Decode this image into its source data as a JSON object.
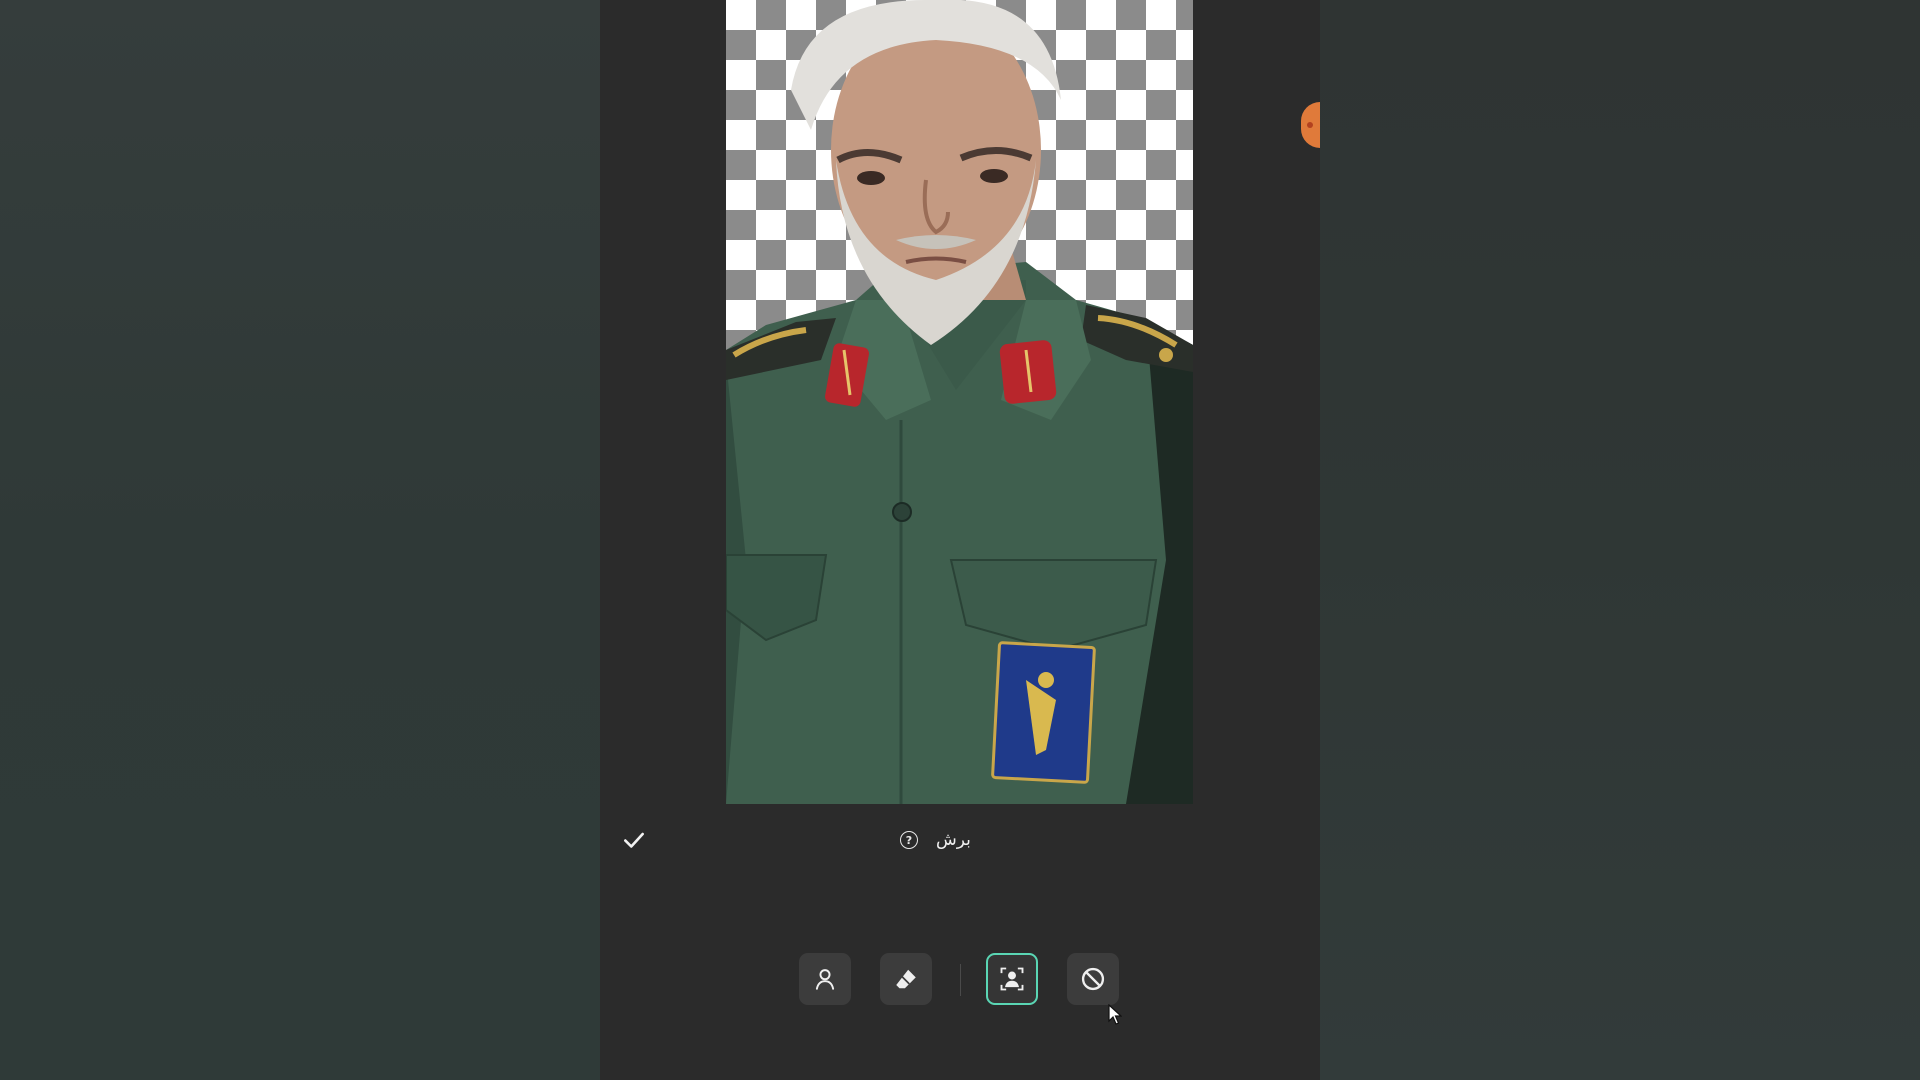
{
  "editor": {
    "title": "برش",
    "help_icon": "?"
  },
  "icons": {
    "confirm": "checkmark-icon",
    "help": "question-circle-icon",
    "tools": [
      "person-outline-icon",
      "eraser-icon",
      "person-select-icon",
      "prohibit-icon"
    ]
  },
  "tools": {
    "active_index": 2
  },
  "colors": {
    "accent": "#5ad6b4",
    "panel": "#2b2b2b",
    "tool_bg": "#3c3c3c",
    "edge_handle": "#e07a3a"
  }
}
